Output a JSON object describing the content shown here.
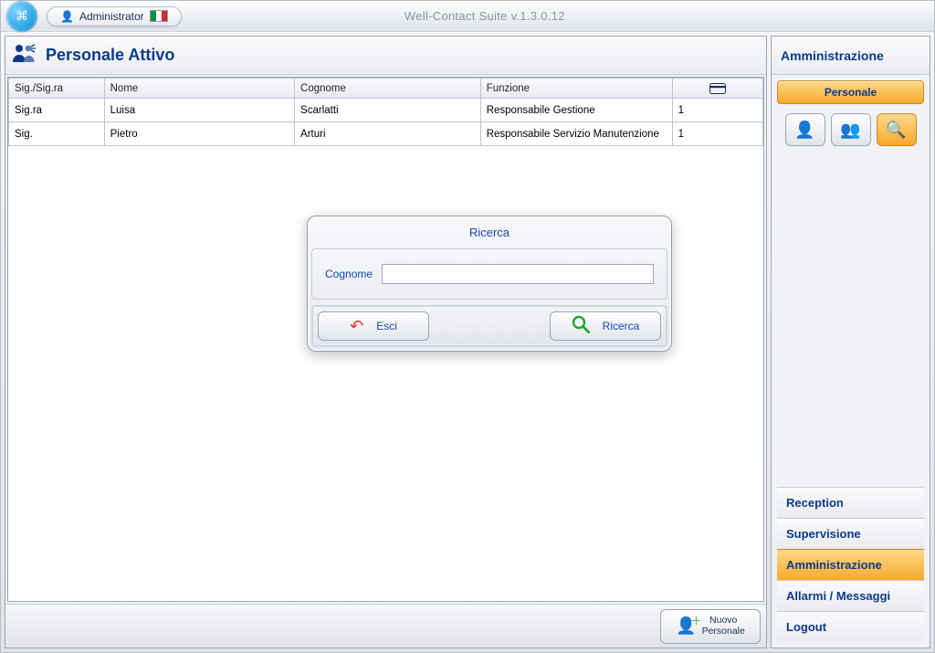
{
  "app": {
    "title": "Well-Contact Suite v.1.3.0.12",
    "user_label": "Administrator",
    "locale_flag": "it"
  },
  "page": {
    "title": "Personale Attivo"
  },
  "table": {
    "columns": {
      "title": "Sig./Sig.ra",
      "first_name": "Nome",
      "last_name": "Cognome",
      "function": "Funzione",
      "card_icon": "card-icon"
    },
    "rows": [
      {
        "title": "Sig.ra",
        "first_name": "Luisa",
        "last_name": "Scarlatti",
        "function": "Responsabile Gestione",
        "card": "1"
      },
      {
        "title": "Sig.",
        "first_name": "Pietro",
        "last_name": "Arturi",
        "function": "Responsabile Servizio Manutenzione",
        "card": "1"
      }
    ]
  },
  "footer": {
    "new_button": "Nuovo\nPersonale"
  },
  "sidebar": {
    "header": "Amministrazione",
    "tab_label": "Personale",
    "nav": [
      {
        "label": "Reception",
        "active": false
      },
      {
        "label": "Supervisione",
        "active": false
      },
      {
        "label": "Amministrazione",
        "active": true
      },
      {
        "label": "Allarmi / Messaggi",
        "active": false
      },
      {
        "label": "Logout",
        "active": false
      }
    ]
  },
  "dialog": {
    "title": "Ricerca",
    "field_label": "Cognome",
    "value": "",
    "placeholder": "",
    "btn_exit": "Esci",
    "btn_search": "Ricerca"
  }
}
